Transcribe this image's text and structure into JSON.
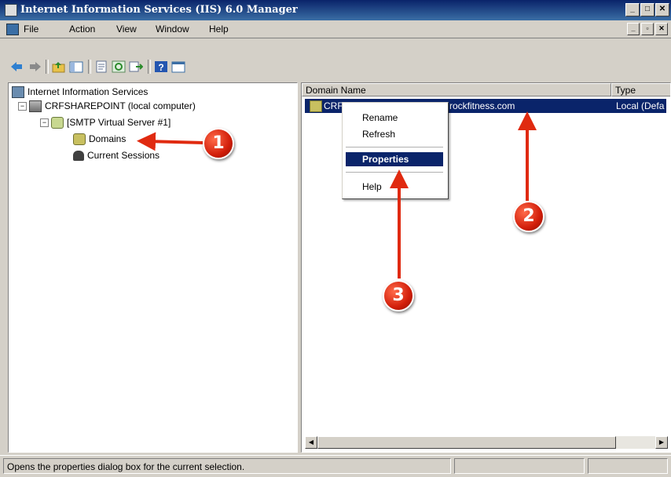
{
  "window": {
    "title": "Internet Information Services (IIS) 6.0 Manager"
  },
  "menu": {
    "items": [
      "File",
      "Action",
      "View",
      "Window",
      "Help"
    ]
  },
  "tree": {
    "root": "Internet Information Services",
    "computer": "CRFSHAREPOINT (local computer)",
    "server": "[SMTP Virtual Server #1]",
    "domains": "Domains",
    "sessions": "Current Sessions"
  },
  "list": {
    "columns": [
      "Domain Name",
      "Type"
    ],
    "rows": [
      {
        "name_start": "CRF",
        "name_end": "rockfitness.com",
        "type": "Local (Defa"
      }
    ]
  },
  "context_menu": {
    "items": [
      "Rename",
      "Refresh",
      "Properties",
      "Help"
    ]
  },
  "annotations": {
    "markers": [
      "1",
      "2",
      "3"
    ],
    "color": "#e02a10"
  },
  "status": {
    "text": "Opens the properties dialog box for the current selection."
  },
  "colors": {
    "selection": "#0a246a",
    "titlebar": "#0a246a",
    "face": "#d4d0c8"
  }
}
